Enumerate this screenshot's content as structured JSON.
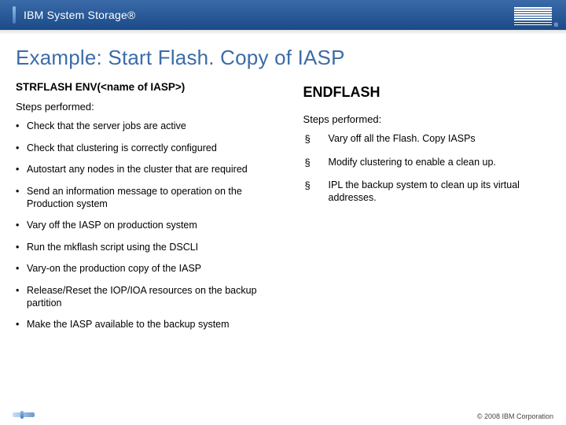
{
  "header": {
    "product": "IBM System Storage®"
  },
  "slide": {
    "title": "Example: Start Flash. Copy of IASP"
  },
  "left": {
    "cmd": "STRFLASH   ENV(<name of IASP>)",
    "steps_label": "Steps performed:",
    "bullets": [
      "Check that the server jobs are active",
      "Check that clustering is correctly configured",
      "Autostart any nodes in the cluster that are required",
      "Send an information message to operation on the Production system",
      "Vary off the IASP on production system",
      "Run the mkflash script using the DSCLI",
      "Vary-on the production copy of the IASP",
      "Release/Reset the IOP/IOA resources on the backup partition",
      "Make the IASP available to the backup system"
    ]
  },
  "right": {
    "cmd": "ENDFLASH",
    "steps_label": "Steps performed:",
    "bullets": [
      "Vary off all the Flash. Copy IASPs",
      "Modify clustering to enable a clean up.",
      "IPL the backup system to clean up its virtual addresses."
    ]
  },
  "footer": {
    "copyright": "© 2008 IBM Corporation"
  }
}
